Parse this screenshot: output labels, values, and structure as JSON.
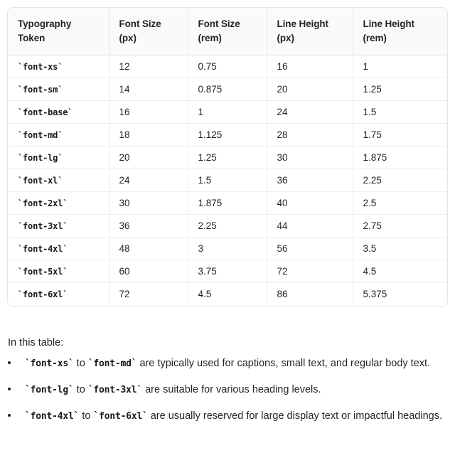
{
  "table": {
    "columns": [
      "Typography Token",
      "Font Size (px)",
      "Font Size (rem)",
      "Line Height (px)",
      "Line Height (rem)"
    ],
    "column_lines": [
      [
        "Typography",
        "Token"
      ],
      [
        "Font Size",
        "(px)"
      ],
      [
        "Font Size",
        "(rem)"
      ],
      [
        "Line Height",
        "(px)"
      ],
      [
        "Line Height",
        "(rem)"
      ]
    ],
    "rows": [
      {
        "token": "`font-xs`",
        "size_px": "12",
        "size_rem": "0.75",
        "lh_px": "16",
        "lh_rem": "1"
      },
      {
        "token": "`font-sm`",
        "size_px": "14",
        "size_rem": "0.875",
        "lh_px": "20",
        "lh_rem": "1.25"
      },
      {
        "token": "`font-base`",
        "size_px": "16",
        "size_rem": "1",
        "lh_px": "24",
        "lh_rem": "1.5"
      },
      {
        "token": "`font-md`",
        "size_px": "18",
        "size_rem": "1.125",
        "lh_px": "28",
        "lh_rem": "1.75"
      },
      {
        "token": "`font-lg`",
        "size_px": "20",
        "size_rem": "1.25",
        "lh_px": "30",
        "lh_rem": "1.875"
      },
      {
        "token": "`font-xl`",
        "size_px": "24",
        "size_rem": "1.5",
        "lh_px": "36",
        "lh_rem": "2.25"
      },
      {
        "token": "`font-2xl`",
        "size_px": "30",
        "size_rem": "1.875",
        "lh_px": "40",
        "lh_rem": "2.5"
      },
      {
        "token": "`font-3xl`",
        "size_px": "36",
        "size_rem": "2.25",
        "lh_px": "44",
        "lh_rem": "2.75"
      },
      {
        "token": "`font-4xl`",
        "size_px": "48",
        "size_rem": "3",
        "lh_px": "56",
        "lh_rem": "3.5"
      },
      {
        "token": "`font-5xl`",
        "size_px": "60",
        "size_rem": "3.75",
        "lh_px": "72",
        "lh_rem": "4.5"
      },
      {
        "token": "`font-6xl`",
        "size_px": "72",
        "size_rem": "4.5",
        "lh_px": "86",
        "lh_rem": "5.375"
      }
    ]
  },
  "intro": "In this table:",
  "bullets": [
    {
      "code_a": "`font-xs`",
      "mid": " to ",
      "code_b": "`font-md`",
      "tail": " are typically used for captions, small text, and regular body text."
    },
    {
      "code_a": "`font-lg`",
      "mid": " to ",
      "code_b": "`font-3xl`",
      "tail": " are suitable for various heading levels."
    },
    {
      "code_a": "`font-4xl`",
      "mid": " to ",
      "code_b": "`font-6xl`",
      "tail": " are usually reserved for large display text or impactful headings."
    }
  ],
  "colors": {
    "text": "#1f2328",
    "table_border": "#e3e5e8",
    "row_divider": "#eceef0",
    "header_bg": "#fafafa",
    "page_bg": "#ffffff"
  }
}
